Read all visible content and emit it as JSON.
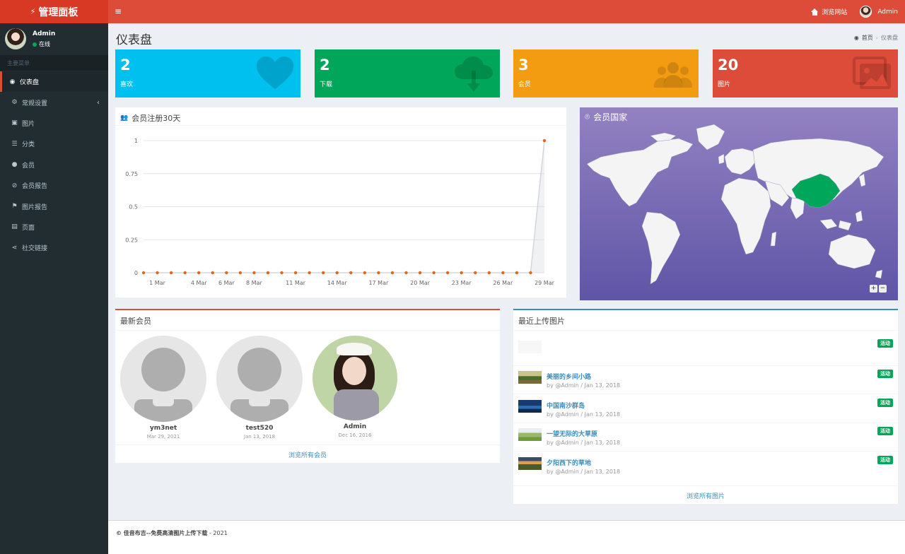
{
  "app": {
    "logo": "管理面板"
  },
  "header": {
    "visit_site": "浏览网站",
    "user": "Admin"
  },
  "sidebar": {
    "user_name": "Admin",
    "status": "在线",
    "menu_header": "主要菜单",
    "items": [
      {
        "label": "仪表盘",
        "icon": "dashboard-icon"
      },
      {
        "label": "常规设置",
        "icon": "cogs-icon"
      },
      {
        "label": "图片",
        "icon": "image-icon"
      },
      {
        "label": "分类",
        "icon": "list-icon"
      },
      {
        "label": "会员",
        "icon": "user-icon"
      },
      {
        "label": "会员报告",
        "icon": "ban-icon"
      },
      {
        "label": "图片报告",
        "icon": "flag-icon"
      },
      {
        "label": "页面",
        "icon": "file-icon"
      },
      {
        "label": "社交链接",
        "icon": "share-icon"
      }
    ]
  },
  "page": {
    "title": "仪表盘",
    "breadcrumb": {
      "home": "首页",
      "current": "仪表盘"
    }
  },
  "stats": [
    {
      "value": "2",
      "label": "喜欢",
      "color": "#00c0ef",
      "icon": "heart-icon"
    },
    {
      "value": "2",
      "label": "下载",
      "color": "#00a65a",
      "icon": "cloud-download-icon"
    },
    {
      "value": "3",
      "label": "会员",
      "color": "#f39c12",
      "icon": "users-icon"
    },
    {
      "value": "20",
      "label": "图片",
      "color": "#dd4b39",
      "icon": "images-icon"
    }
  ],
  "registrations": {
    "title": "会员注册30天",
    "chart_data": {
      "type": "line",
      "title": "会员注册30天",
      "ylim": [
        0,
        1
      ],
      "yticks": [
        "0",
        "0.25",
        "0.5",
        "0.75",
        "1"
      ],
      "xticks": [
        "1 Mar",
        "4 Mar",
        "6 Mar",
        "8 Mar",
        "11 Mar",
        "14 Mar",
        "17 Mar",
        "20 Mar",
        "23 Mar",
        "26 Mar",
        "29 Mar"
      ],
      "values": [
        0,
        0,
        0,
        0,
        0,
        0,
        0,
        0,
        0,
        0,
        0,
        0,
        0,
        0,
        0,
        0,
        0,
        0,
        0,
        0,
        0,
        0,
        0,
        0,
        0,
        0,
        0,
        0,
        0,
        1
      ],
      "grid": true,
      "point_color": "#e8641b"
    }
  },
  "map": {
    "title": "会员国家",
    "highlight": "China",
    "highlight_color": "#00a65a",
    "zoom_in": "+",
    "zoom_out": "−"
  },
  "members": {
    "title": "最新会员",
    "list": [
      {
        "name": "ym3net",
        "date": "Mar 29, 2021"
      },
      {
        "name": "test520",
        "date": "Jan 13, 2018"
      },
      {
        "name": "Admin",
        "date": "Dec 16, 2016"
      }
    ],
    "footer_link": "浏览所有会员"
  },
  "uploads": {
    "title": "最近上传图片",
    "badge": "活动",
    "items": [
      {
        "title": "",
        "meta": ""
      },
      {
        "title": "美丽的乡间小路",
        "meta": "by @Admin / Jan 13, 2018"
      },
      {
        "title": "中国南沙群岛",
        "meta": "by @Admin / Jan 13, 2018"
      },
      {
        "title": "一望无际的大草原",
        "meta": "by @Admin / Jan 13, 2018"
      },
      {
        "title": "夕阳西下的草地",
        "meta": "by @Admin / Jan 13, 2018"
      }
    ],
    "footer_link": "浏览所有图片"
  },
  "footer": {
    "copyright": "© 佳音布吉--免费高清图片上传下载",
    "year": " - 2021"
  }
}
